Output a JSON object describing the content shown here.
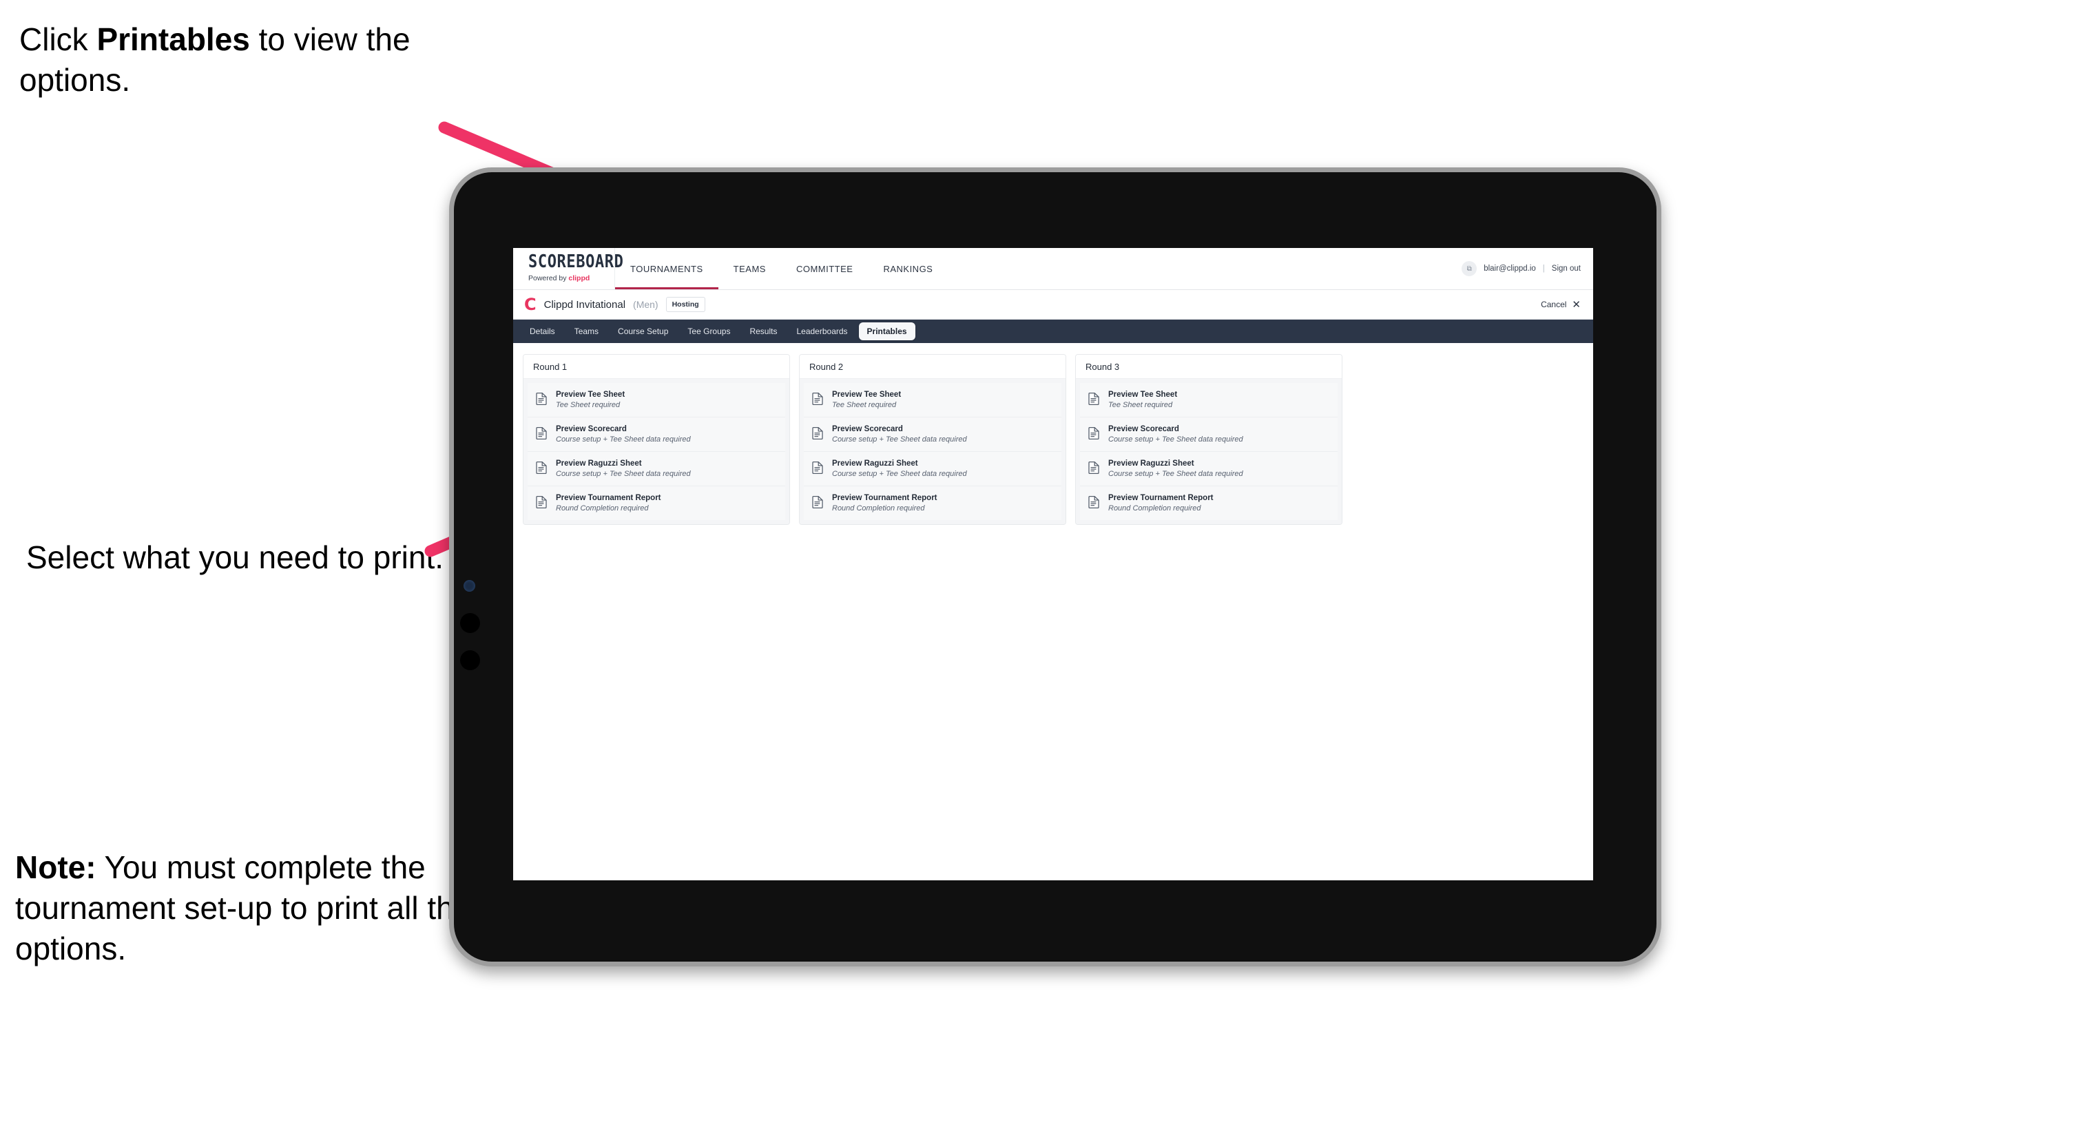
{
  "annotations": {
    "top": {
      "pre": "Click ",
      "strong": "Printables",
      "post": " to view the options."
    },
    "middle": {
      "text": "Select what you need to print."
    },
    "note": {
      "strong": "Note:",
      "text": " You must complete the tournament set-up to print all the options."
    }
  },
  "colors": {
    "accent_pink": "#ef3366",
    "nav_dark": "#2c3648",
    "brand_red": "#e8345f"
  },
  "app": {
    "brand": {
      "title": "SCOREBOARD",
      "powered_prefix": "Powered by ",
      "powered_name": "clippd"
    },
    "nav": [
      {
        "label": "TOURNAMENTS",
        "active": true
      },
      {
        "label": "TEAMS",
        "active": false
      },
      {
        "label": "COMMITTEE",
        "active": false
      },
      {
        "label": "RANKINGS",
        "active": false
      }
    ],
    "account": {
      "avatar_glyph": "⧉",
      "email": "blair@clippd.io",
      "separator": "|",
      "sign_out": "Sign out"
    },
    "tournament": {
      "logo_letter": "C",
      "name": "Clippd Invitational",
      "gender": "(Men)",
      "badge": "Hosting",
      "cancel_label": "Cancel",
      "cancel_icon": "✕"
    },
    "tabs": [
      {
        "label": "Details",
        "active": false
      },
      {
        "label": "Teams",
        "active": false
      },
      {
        "label": "Course Setup",
        "active": false
      },
      {
        "label": "Tee Groups",
        "active": false
      },
      {
        "label": "Results",
        "active": false
      },
      {
        "label": "Leaderboards",
        "active": false
      },
      {
        "label": "Printables",
        "active": true
      }
    ],
    "rounds": [
      {
        "title": "Round 1",
        "items": [
          {
            "icon": "document-icon",
            "title": "Preview Tee Sheet",
            "subtitle": "Tee Sheet required"
          },
          {
            "icon": "document-icon",
            "title": "Preview Scorecard",
            "subtitle": "Course setup + Tee Sheet data required"
          },
          {
            "icon": "document-icon",
            "title": "Preview Raguzzi Sheet",
            "subtitle": "Course setup + Tee Sheet data required"
          },
          {
            "icon": "document-icon",
            "title": "Preview Tournament Report",
            "subtitle": "Round Completion required"
          }
        ]
      },
      {
        "title": "Round 2",
        "items": [
          {
            "icon": "document-icon",
            "title": "Preview Tee Sheet",
            "subtitle": "Tee Sheet required"
          },
          {
            "icon": "document-icon",
            "title": "Preview Scorecard",
            "subtitle": "Course setup + Tee Sheet data required"
          },
          {
            "icon": "document-icon",
            "title": "Preview Raguzzi Sheet",
            "subtitle": "Course setup + Tee Sheet data required"
          },
          {
            "icon": "document-icon",
            "title": "Preview Tournament Report",
            "subtitle": "Round Completion required"
          }
        ]
      },
      {
        "title": "Round 3",
        "items": [
          {
            "icon": "document-icon",
            "title": "Preview Tee Sheet",
            "subtitle": "Tee Sheet required"
          },
          {
            "icon": "document-icon",
            "title": "Preview Scorecard",
            "subtitle": "Course setup + Tee Sheet data required"
          },
          {
            "icon": "document-icon",
            "title": "Preview Raguzzi Sheet",
            "subtitle": "Course setup + Tee Sheet data required"
          },
          {
            "icon": "document-icon",
            "title": "Preview Tournament Report",
            "subtitle": "Round Completion required"
          }
        ]
      }
    ]
  }
}
